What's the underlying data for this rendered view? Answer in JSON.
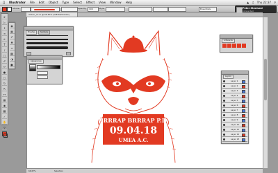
{
  "menubar": {
    "app_name": "Illustrator",
    "items": [
      "File",
      "Edit",
      "Object",
      "Type",
      "Select",
      "Effect",
      "View",
      "Window",
      "Help"
    ],
    "clock": "Thu 22:37",
    "wifi_icon": "wifi-icon"
  },
  "controlbar": {
    "stroke_label": "Stroke:",
    "style_label": "Style:",
    "opacity_label": "Opacity:",
    "opacity_value": "100",
    "preset": "Essentials",
    "fill_color": "#e23a22"
  },
  "document": {
    "tab_title": "larson_v1.ai @ 66.67% (CMYK/Preview)"
  },
  "notification": {
    "title": "Peter Stenlund",
    "subtitle": "connected"
  },
  "panels": {
    "brushes_tab": "Brushes",
    "symbols_tab": "Symbols",
    "appearance_tab": "Appearance",
    "layers_tab": "Layers",
    "artboards_tab": "Artboards"
  },
  "layers": [
    {
      "name": "Layer 1",
      "color": "#4a78d8"
    },
    {
      "name": "Layer 2",
      "color": "#e23a22"
    },
    {
      "name": "Layer 3",
      "color": "#4a78d8"
    },
    {
      "name": "Layer 4",
      "color": "#e23a22"
    },
    {
      "name": "Layer 5",
      "color": "#4a78d8"
    },
    {
      "name": "Layer 6",
      "color": "#e23a22"
    },
    {
      "name": "Layer 7",
      "color": "#4a78d8"
    },
    {
      "name": "Layer 8",
      "color": "#e23a22"
    },
    {
      "name": "Layer 9",
      "color": "#4a78d8"
    },
    {
      "name": "Layer 10",
      "color": "#e23a22"
    },
    {
      "name": "Layer 11",
      "color": "#4a78d8"
    },
    {
      "name": "Layer 12",
      "color": "#e23a22"
    },
    {
      "name": "Layer 13",
      "color": "#4a78d8"
    }
  ],
  "artwork": {
    "sign_line1": "BRRRAP BRRRAP P.D.",
    "sign_line2": "09.04.18",
    "sign_line3": "UMEA A.C.",
    "color": "#e23a22"
  },
  "statusbar": {
    "zoom": "66.67%",
    "tool": "Selection"
  }
}
